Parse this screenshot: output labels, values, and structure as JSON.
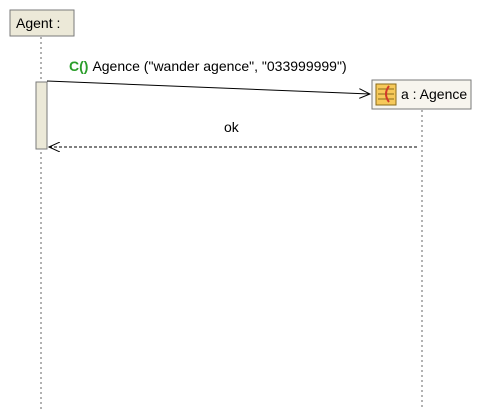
{
  "diagram": {
    "type": "sequence",
    "lifelines": [
      {
        "id": "agent",
        "label": "Agent :"
      },
      {
        "id": "agence",
        "label": "a : Agence",
        "icon": "class-instance-icon"
      }
    ],
    "messages": [
      {
        "from": "agent",
        "to": "agence",
        "kind": "create",
        "stereotype": "C()",
        "label": "Agence (\"wander agence\", \"033999999\")",
        "line_style": "solid"
      },
      {
        "from": "agence",
        "to": "agent",
        "kind": "return",
        "label": "ok",
        "line_style": "dashed"
      }
    ],
    "colors": {
      "lifeline_box_fill": "#ece9d8",
      "activation_fill": "#ece9d8",
      "instance_box_fill": "#f7f5ee",
      "border": "#7a7a7a",
      "stereotype": "#2a9d2a",
      "icon_fill": "#f6c95a",
      "icon_accent": "#d13a2a"
    }
  }
}
